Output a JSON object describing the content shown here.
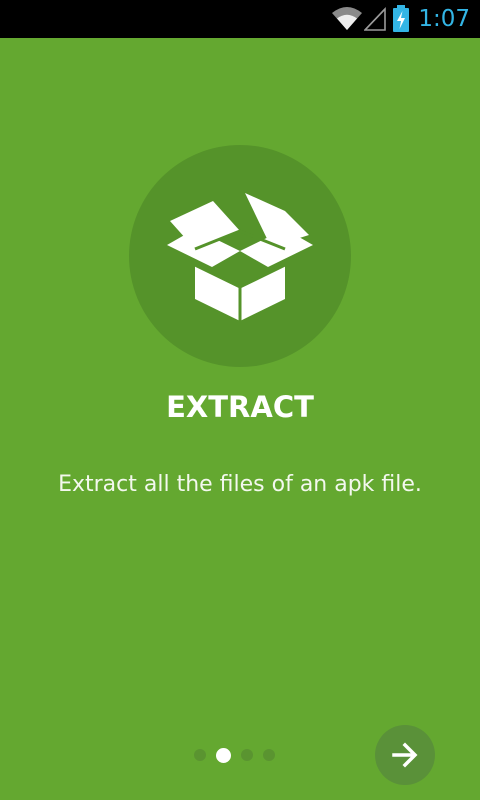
{
  "status_bar": {
    "time": "1:07",
    "icons": [
      "wifi-icon",
      "cell-signal-icon",
      "battery-charging-icon"
    ],
    "accent_color": "#33b5e5"
  },
  "slide": {
    "icon": "open-box-icon",
    "title": "EXTRACT",
    "description": "Extract all the files of an apk file."
  },
  "pager": {
    "total": 4,
    "active_index": 1
  },
  "next_button": {
    "icon": "arrow-right-icon"
  },
  "colors": {
    "background": "#64a830",
    "circle": "#55932a",
    "button": "#5a9139"
  }
}
